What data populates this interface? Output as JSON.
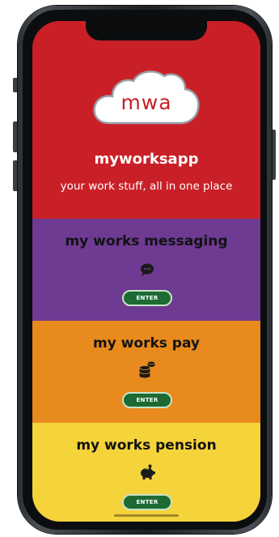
{
  "app": {
    "logo_text": "mwa",
    "title": "myworksapp",
    "tagline": "your work stuff, all in one place"
  },
  "sections": [
    {
      "title": "my works messaging",
      "icon": "chat-bubble-icon",
      "button": "ENTER",
      "color": "#6e3a92"
    },
    {
      "title": "my works pay",
      "icon": "coins-stack-icon",
      "button": "ENTER",
      "color": "#e88a1e"
    },
    {
      "title": "my works pension",
      "icon": "piggy-bank-icon",
      "button": "ENTER",
      "color": "#f5d33b"
    }
  ],
  "colors": {
    "header": "#c92027",
    "button": "#1d6b32"
  }
}
